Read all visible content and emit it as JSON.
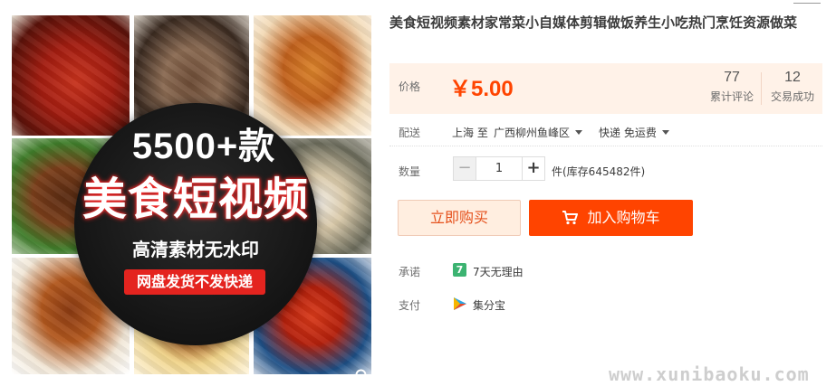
{
  "product": {
    "title": "美食短视频素材家常菜小自媒体剪辑做饭养生小吃热门烹饪资源做菜"
  },
  "gallery": {
    "promo_count": "5500+款",
    "promo_title": "美食短视频",
    "promo_sub": "高清素材无水印",
    "promo_ribbon": "网盘发货不发快递",
    "zoom_icon": "magnifier-icon"
  },
  "price": {
    "label": "价格",
    "value": "￥5.00",
    "reviews_count": "77",
    "reviews_label": "累计评论",
    "deals_count": "12",
    "deals_label": "交易成功"
  },
  "shipping": {
    "label": "配送",
    "from": "上海 至",
    "destination": "广西柳州鱼峰区",
    "method": "快递 免运费"
  },
  "quantity": {
    "label": "数量",
    "value": "1",
    "stock": "件(库存645482件)"
  },
  "actions": {
    "buy_now": "立即购买",
    "add_cart": "加入购物车",
    "cart_icon": "cart-icon"
  },
  "promise": {
    "label": "承诺",
    "badge": "7",
    "text": "7天无理由"
  },
  "payment": {
    "label": "支付",
    "text": "集分宝"
  },
  "watermark": "www.xunibaoku.com",
  "colors": {
    "accent": "#ff4400",
    "price": "#ff4400",
    "price_bg": "#fff2e8"
  }
}
